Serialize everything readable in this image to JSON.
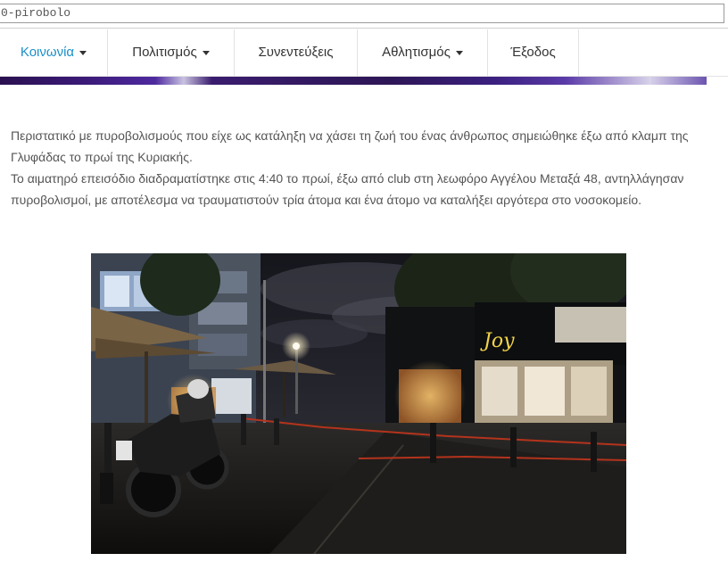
{
  "address_bar": {
    "url_text": "0-pirobolo"
  },
  "nav": {
    "items": [
      {
        "label": "Κοινωνία",
        "dropdown": true,
        "active": true
      },
      {
        "label": "Πολιτισμός",
        "dropdown": true,
        "active": false
      },
      {
        "label": "Συνεντεύξεις",
        "dropdown": false,
        "active": false
      },
      {
        "label": "Αθλητισμός",
        "dropdown": true,
        "active": false
      },
      {
        "label": "Έξοδος",
        "dropdown": false,
        "active": false
      }
    ]
  },
  "article": {
    "paragraph_1": "Περιστατικό με πυροβολισμούς που είχε ως κατάληξη να χάσει τη ζωή του ένας άνθρωπος σημειώθηκε έξω από κλαμπ της Γλυφάδας το πρωί της Κυριακής.",
    "paragraph_2": "Το αιματηρό επεισόδιο διαδραματίστηκε στις 4:40 το πρωί, έξω από club στη λεωφόρο Αγγέλου Μεταξά 48, αντηλλάγησαν πυροβολισμοί, με αποτέλεσμα να τραυματιστούν τρία άτομα και ένα άτομο να καταλήξει αργότερα στο νοσοκομείο."
  },
  "photo": {
    "sign_text": "Joy"
  },
  "colors": {
    "active_nav": "#1a8fc9",
    "body_text": "#555555",
    "banner": "#3b1a78"
  }
}
